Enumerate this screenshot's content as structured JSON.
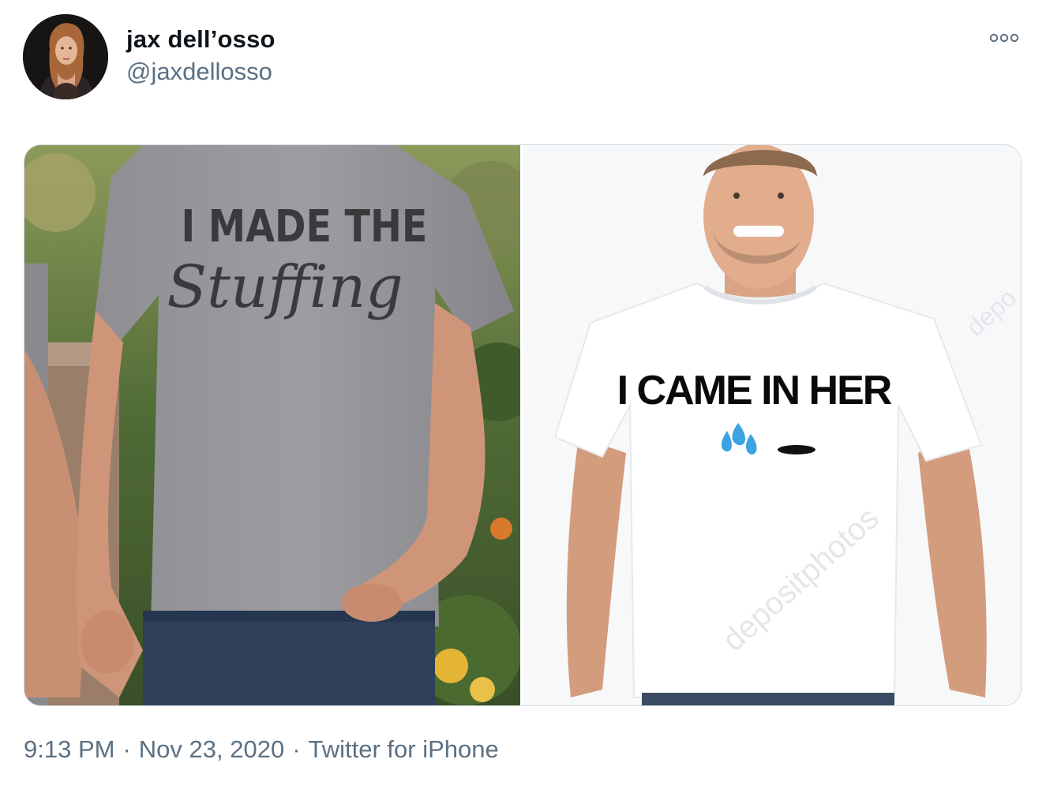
{
  "author": {
    "display_name": "jax dell’osso",
    "handle": "@jaxdellosso",
    "avatar_icon": "profile-photo"
  },
  "more_icon": "ellipsis-icon",
  "media": {
    "left_shirt_line1": "I MADE THE",
    "left_shirt_line2": "Stuffing",
    "right_shirt_text": "I CAME IN HER",
    "right_emoji_droplets": "💦",
    "right_watermark": "depositphotos",
    "right_watermark_side": "depo"
  },
  "meta": {
    "time": "9:13 PM",
    "date": "Nov 23, 2020",
    "source": "Twitter for iPhone",
    "separator": "·"
  },
  "colors": {
    "secondary_text": "#5b7083",
    "primary_text": "#0f1419",
    "border": "#cfd9de"
  }
}
